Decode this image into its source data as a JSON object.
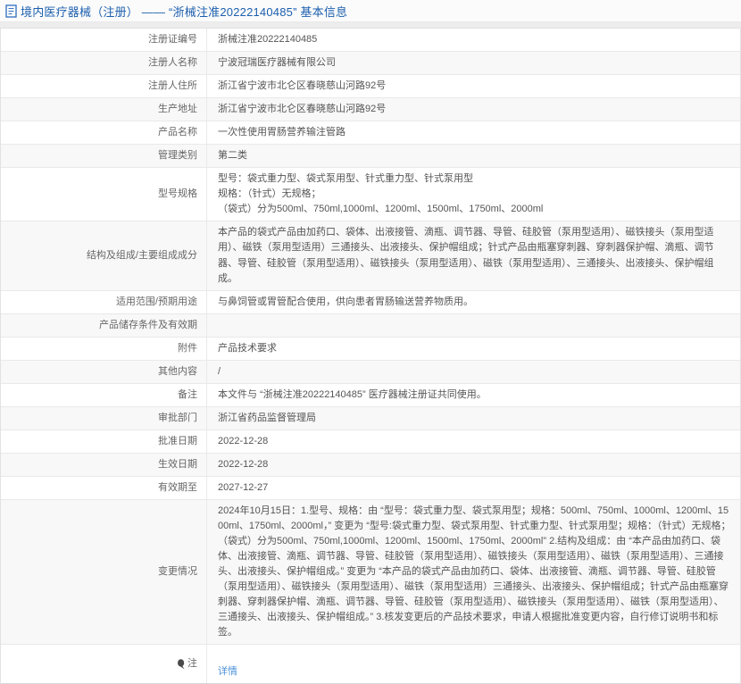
{
  "page_title": {
    "text": "境内医疗器械（注册） —— “浙械注准20222140485” 基本信息",
    "icon": "document-icon",
    "color": "#1c5fae"
  },
  "colors": {
    "title_blue": "#1c5fae",
    "link_blue": "#4a90d9",
    "row_alt_bg": "#f8f8f8",
    "border": "#e9e9e9",
    "page_bg": "#ededed"
  },
  "table": {
    "rows": [
      {
        "label": "注册证编号",
        "value": "浙械注准20222140485"
      },
      {
        "label": "注册人名称",
        "value": "宁波冠瑞医疗器械有限公司"
      },
      {
        "label": "注册人住所",
        "value": "浙江省宁波市北仑区春晓慈山河路92号"
      },
      {
        "label": "生产地址",
        "value": "浙江省宁波市北仑区春晓慈山河路92号"
      },
      {
        "label": "产品名称",
        "value": "一次性使用胃肠营养输注管路"
      },
      {
        "label": "管理类别",
        "value": "第二类"
      },
      {
        "label": "型号规格",
        "value": "型号：袋式重力型、袋式泵用型、针式重力型、针式泵用型\n规格：（针式）无规格；\n（袋式）分为500ml、750ml,1000ml、1200ml、1500ml、1750ml、2000ml"
      },
      {
        "label": "结构及组成/主要组成成分",
        "value": "本产品的袋式产品由加药口、袋体、出液接管、滴瓶、调节器、导管、硅胶管（泵用型适用）、磁铁接头（泵用型适用）、磁铁（泵用型适用）三通接头、出液接头、保护帽组成；针式产品由瓶塞穿刺器、穿刺器保护帽、滴瓶、调节器、导管、硅胶管（泵用型适用）、磁铁接头（泵用型适用）、磁铁（泵用型适用）、三通接头、出液接头、保护帽组成。"
      },
      {
        "label": "适用范围/预期用途",
        "value": "与鼻饲管或胃管配合使用，供向患者胃肠输送营养物质用。"
      },
      {
        "label": "产品储存条件及有效期",
        "value": ""
      },
      {
        "label": "附件",
        "value": "产品技术要求"
      },
      {
        "label": "其他内容",
        "value": "/"
      },
      {
        "label": "备注",
        "value": "本文件与 “浙械注准20222140485” 医疗器械注册证共同使用。"
      },
      {
        "label": "审批部门",
        "value": "浙江省药品监督管理局"
      },
      {
        "label": "批准日期",
        "value": "2022-12-28"
      },
      {
        "label": "生效日期",
        "value": "2022-12-28"
      },
      {
        "label": "有效期至",
        "value": "2027-12-27"
      },
      {
        "label": "变更情况",
        "value": "2024年10月15日：1.型号、规格：由 “型号：袋式重力型、袋式泵用型；规格：500ml、750ml、1000ml、1200ml、1500ml、1750ml、2000ml，” 变更为 “型号:袋式重力型、袋式泵用型、针式重力型、针式泵用型；规格：（针式）无规格；（袋式）分为500ml、750ml,1000ml、1200ml、1500ml、1750ml、2000ml” 2.结构及组成：由 “本产品由加药口、袋体、出液接管、滴瓶、调节器、导管、硅胶管（泵用型适用）、磁铁接头（泵用型适用）、磁铁（泵用型适用）、三通接头、出液接头、保护帽组成。” 变更为 “本产品的袋式产品由加药口、袋体、出液接管、滴瓶、调节器、导管、硅胶管（泵用型适用）、磁铁接头（泵用型适用）、磁铁（泵用型适用）三通接头、出液接头、保护帽组成；针式产品由瓶塞穿刺器、穿刺器保护帽、滴瓶、调节器、导管、硅胶管（泵用型适用）、磁铁接头（泵用型适用）、磁铁（泵用型适用）、三通接头、出液接头、保护帽组成。” 3.核发变更后的产品技术要求，申请人根据批准变更内容，自行修订说明书和标签。"
      }
    ],
    "note_row": {
      "label": "注",
      "link_label": "详情",
      "icon": "note-pin-icon"
    }
  }
}
